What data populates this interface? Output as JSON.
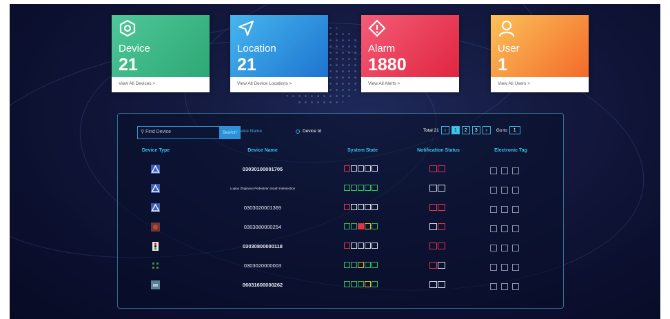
{
  "cards": [
    {
      "title": "Device",
      "value": "21",
      "link": "View All Devices >",
      "icon": "hexagon-icon",
      "colors": [
        "#4fc79a",
        "#2ea874"
      ]
    },
    {
      "title": "Location",
      "value": "21",
      "link": "View All Device Locations >",
      "icon": "navigation-arrow-icon",
      "colors": [
        "#46b6ef",
        "#1e74cf"
      ]
    },
    {
      "title": "Alarm",
      "value": "1880",
      "link": "View All Alerts >",
      "icon": "alert-diamond-icon",
      "colors": [
        "#f45c78",
        "#e02640"
      ]
    },
    {
      "title": "User",
      "value": "1",
      "link": "View All Users >",
      "icon": "user-icon",
      "colors": [
        "#fbc25a",
        "#f36a2a"
      ]
    }
  ],
  "search": {
    "placeholder": "Find Device",
    "button": "Search"
  },
  "radios": {
    "device_name": "Device Name",
    "device_id": "Device Id",
    "selected": "device_name"
  },
  "pager": {
    "total_label": "Total 21",
    "pages": [
      "1",
      "2",
      "3"
    ],
    "current": "1",
    "goto_label": "Go to",
    "goto_value": "1"
  },
  "columns": {
    "type": "Device Type",
    "name": "Device Name",
    "system": "System State",
    "notification": "Notification Status",
    "tag": "Electronic Tag"
  },
  "rows": [
    {
      "name": "03030100001705",
      "type_icon": "triangle-sign-icon",
      "bold": true,
      "system": [
        "red",
        "white",
        "white",
        "white",
        "white"
      ],
      "notif": [
        "red",
        "red"
      ]
    },
    {
      "name": "Luqiao Zhajiacun Pedestrian South Intersection",
      "type_icon": "triangle-sign-icon",
      "bold": false,
      "small": true,
      "system": [
        "green",
        "green",
        "green",
        "green",
        "green"
      ],
      "notif": [
        "white",
        "white"
      ]
    },
    {
      "name": "0303020001369",
      "type_icon": "triangle-sign-icon",
      "bold": false,
      "system": [
        "red",
        "white",
        "white",
        "white",
        "white"
      ],
      "notif": [
        "red",
        "red"
      ]
    },
    {
      "name": "0303080000254",
      "type_icon": "camera-device-icon",
      "bold": false,
      "system": [
        "green",
        "green",
        "red",
        "yellow",
        "green"
      ],
      "notif": [
        "white",
        "red"
      ]
    },
    {
      "name": "03030800000118",
      "type_icon": "traffic-light-icon",
      "bold": true,
      "system": [
        "red",
        "white",
        "white",
        "white",
        "white"
      ],
      "notif": [
        "red",
        "red"
      ]
    },
    {
      "name": "0303020000003",
      "type_icon": "sensor-device-icon",
      "bold": false,
      "system": [
        "green",
        "green",
        "yellow",
        "green",
        "green"
      ],
      "notif": [
        "red",
        "white"
      ]
    },
    {
      "name": "06031600000262",
      "type_icon": "router-device-icon",
      "bold": true,
      "system": [
        "green",
        "green",
        "green",
        "yellow",
        "green"
      ],
      "notif": [
        "white",
        "white"
      ]
    }
  ]
}
